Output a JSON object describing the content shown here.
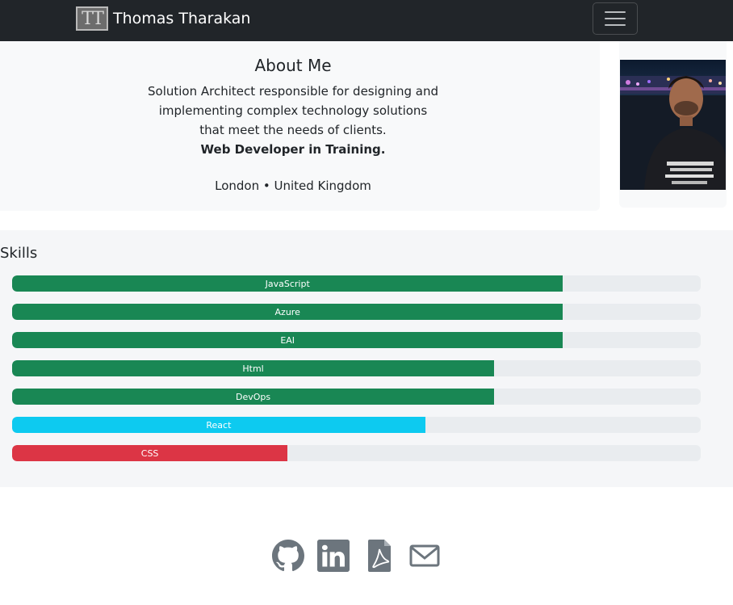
{
  "navbar": {
    "logo_text": "TT",
    "brand_name": "Thomas Tharakan",
    "toggler_icon": "hamburger-menu-icon"
  },
  "about": {
    "title": "About Me",
    "line1": "Solution Architect responsible for designing and",
    "line2": "implementing complex technology solutions",
    "line3": "that meet the needs of clients.",
    "highlight": "Web Developer in Training.",
    "location": "London • United Kingdom"
  },
  "skills": {
    "title": "Skills",
    "items": [
      {
        "label": "JavaScript",
        "percent": 80,
        "color": "#198754"
      },
      {
        "label": "Azure",
        "percent": 80,
        "color": "#198754"
      },
      {
        "label": "EAI",
        "percent": 80,
        "color": "#198754"
      },
      {
        "label": "Html",
        "percent": 70,
        "color": "#198754"
      },
      {
        "label": "DevOps",
        "percent": 70,
        "color": "#198754"
      },
      {
        "label": "React",
        "percent": 60,
        "color": "#0dcaf0"
      },
      {
        "label": "CSS",
        "percent": 40,
        "color": "#dc3545"
      }
    ]
  },
  "footer": {
    "icons": [
      "github-icon",
      "linkedin-icon",
      "pdf-icon",
      "mail-icon"
    ]
  }
}
